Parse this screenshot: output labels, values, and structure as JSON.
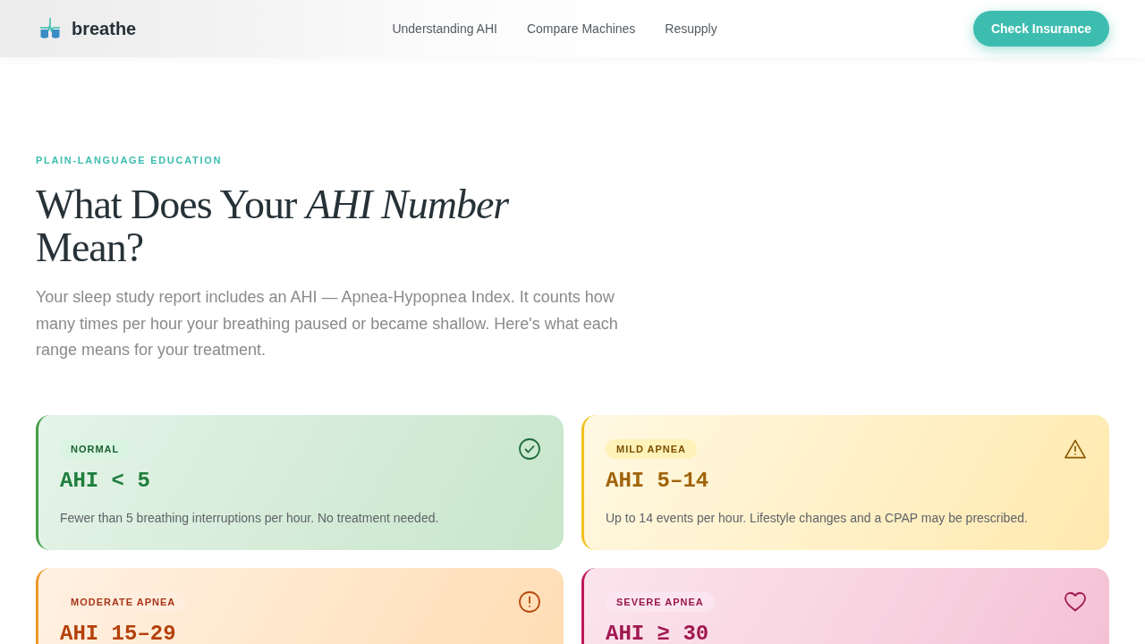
{
  "header": {
    "brand": "breathe",
    "nav": [
      {
        "label": "Understanding AHI"
      },
      {
        "label": "Compare Machines"
      },
      {
        "label": "Resupply"
      }
    ],
    "cta": "Check Insurance"
  },
  "hero": {
    "eyebrow": "PLAIN-LANGUAGE EDUCATION",
    "title": "What Does Your *AHI Number* Mean?",
    "intro": "Your sleep study report includes an AHI — Apnea-Hypopnea Index. It counts how many times per hour your breathing paused or became shallow. Here's what each range means for your treatment."
  },
  "levels": [
    {
      "kind": "normal",
      "badge": "NORMAL",
      "range": "AHI < 5",
      "description": "Fewer than 5 breathing interruptions per hour. No treatment needed.",
      "color": "#1e7e3e"
    },
    {
      "kind": "mild",
      "badge": "MILD APNEA",
      "range": "AHI 5–14",
      "description": "Up to 14 events per hour. Lifestyle changes and a CPAP may be prescribed.",
      "color": "#a0640a"
    },
    {
      "kind": "moderate",
      "badge": "MODERATE APNEA",
      "range": "AHI 15–29",
      "color": "#b5400a"
    },
    {
      "kind": "severe",
      "badge": "SEVERE APNEA",
      "range": "AHI ≥ 30",
      "color": "#a01850"
    }
  ]
}
